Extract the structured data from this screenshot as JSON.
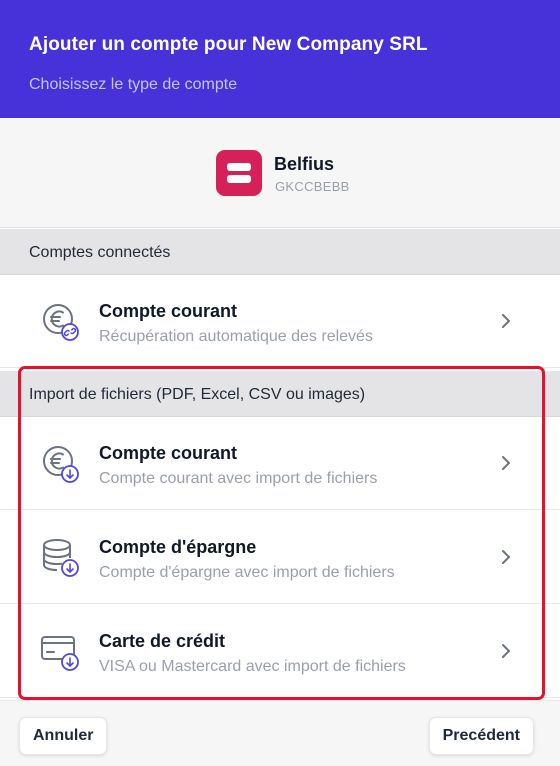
{
  "header": {
    "title": "Ajouter un compte pour New Company SRL",
    "subtitle": "Choisissez le type de compte"
  },
  "bank": {
    "name": "Belfius",
    "code": "GKCCBEBB",
    "logo_color": "#d6205a"
  },
  "sections": [
    {
      "title": "Comptes connectés",
      "items": [
        {
          "title": "Compte courant",
          "subtitle": "Récupération automatique des relevés",
          "icon": "euro-link-icon"
        }
      ]
    },
    {
      "title": "Import de fichiers (PDF, Excel, CSV ou images)",
      "items": [
        {
          "title": "Compte courant",
          "subtitle": "Compte courant avec import de fichiers",
          "icon": "euro-download-icon"
        },
        {
          "title": "Compte d'épargne",
          "subtitle": "Compte d'épargne avec import de fichiers",
          "icon": "coins-download-icon"
        },
        {
          "title": "Carte de crédit",
          "subtitle": "VISA ou Mastercard avec import de fichiers",
          "icon": "card-download-icon"
        }
      ]
    }
  ],
  "footer": {
    "cancel_label": "Annuler",
    "previous_label": "Precédent"
  },
  "colors": {
    "header_bg": "#4731d8",
    "accent": "#4f46e5",
    "highlight": "#e8102a"
  }
}
